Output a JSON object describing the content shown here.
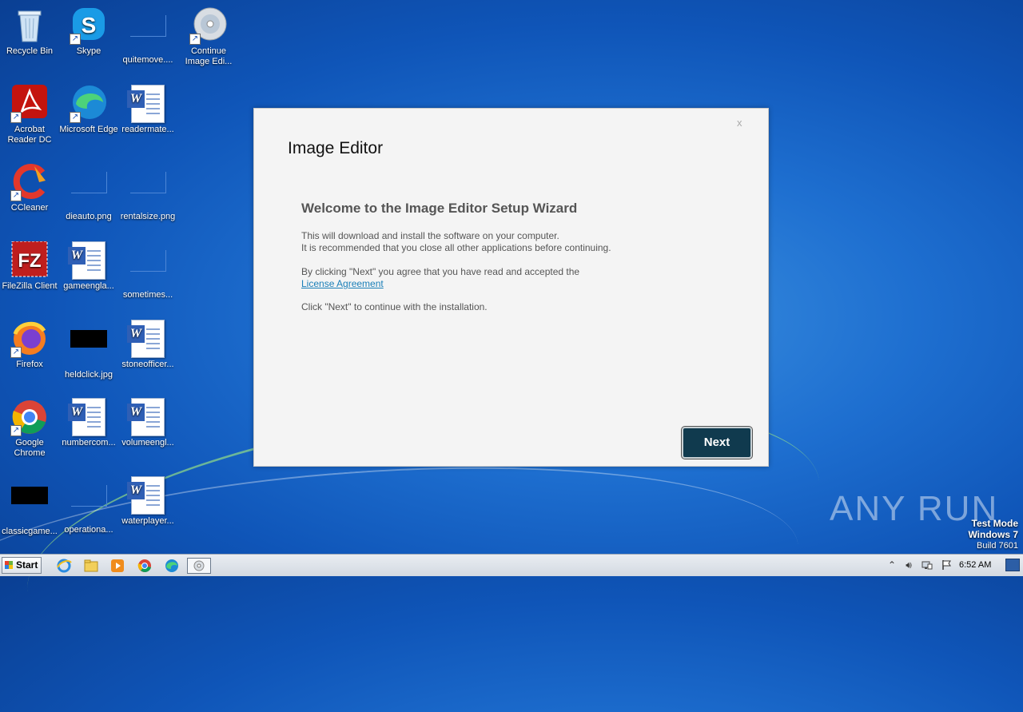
{
  "desktop": {
    "icons": [
      {
        "label": "Recycle Bin"
      },
      {
        "label": "Skype"
      },
      {
        "label": "quitemove...."
      },
      {
        "label": "Continue Image Edi..."
      },
      {
        "label": "Acrobat Reader DC"
      },
      {
        "label": "Microsoft Edge"
      },
      {
        "label": "readermate..."
      },
      {
        "label": "CCleaner"
      },
      {
        "label": "dieauto.png"
      },
      {
        "label": "rentalsize.png"
      },
      {
        "label": "FileZilla Client"
      },
      {
        "label": "gameengla..."
      },
      {
        "label": "sometimes..."
      },
      {
        "label": "Firefox"
      },
      {
        "label": "heldclick.jpg"
      },
      {
        "label": "stoneofficer..."
      },
      {
        "label": "Google Chrome"
      },
      {
        "label": "numbercom..."
      },
      {
        "label": "volumeengl..."
      },
      {
        "label": "classicgame..."
      },
      {
        "label": "operationa..."
      },
      {
        "label": "waterplayer..."
      }
    ]
  },
  "dialog": {
    "close_label": "x",
    "title": "Image Editor",
    "heading": "Welcome to the Image Editor Setup Wizard",
    "line1": "This will download and install the software on your computer.",
    "line2": "It is recommended that you close all other applications before continuing.",
    "line3": "By clicking \"Next\" you agree that you have read and accepted the",
    "license_link": "License Agreement",
    "line4": "Click \"Next\" to continue with the installation.",
    "next_label": "Next"
  },
  "watermark": {
    "brand": "ANY RUN",
    "mode": "Test Mode",
    "os": "Windows 7",
    "build": "Build 7601"
  },
  "taskbar": {
    "start_label": "Start",
    "clock": "6:52 AM",
    "colors": {
      "start_flag": [
        "#e8402a",
        "#6ab43c",
        "#2a7fe0",
        "#f4c20d"
      ]
    }
  }
}
